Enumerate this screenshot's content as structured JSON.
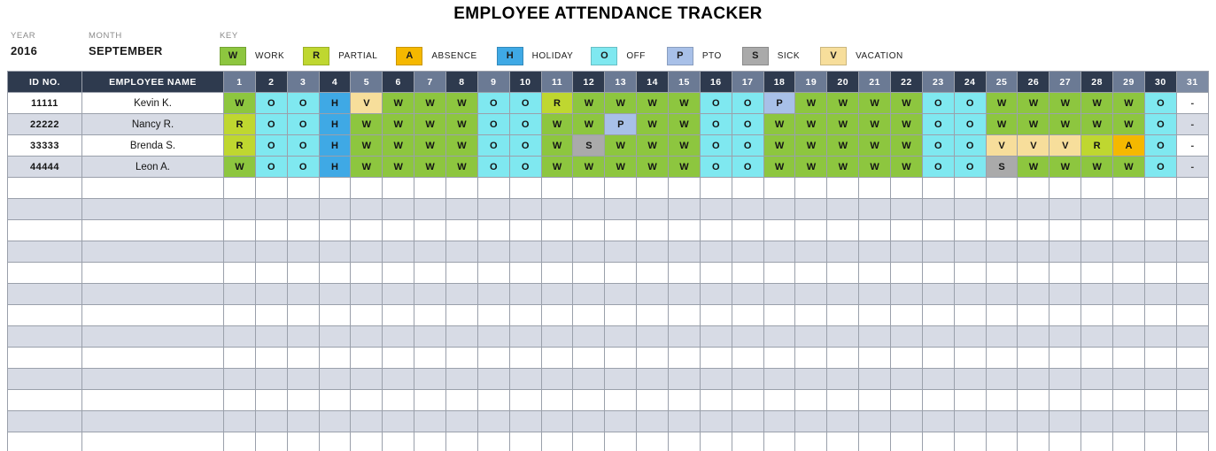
{
  "title": "EMPLOYEE ATTENDANCE TRACKER",
  "meta": {
    "year_label": "YEAR",
    "year_value": "2016",
    "month_label": "MONTH",
    "month_value": "SEPTEMBER",
    "key_label": "KEY"
  },
  "legend": [
    {
      "code": "W",
      "label": "WORK",
      "color": "#8DC63F"
    },
    {
      "code": "R",
      "label": "PARTIAL",
      "color": "#BFD730"
    },
    {
      "code": "A",
      "label": "ABSENCE",
      "color": "#F5B800"
    },
    {
      "code": "H",
      "label": "HOLIDAY",
      "color": "#3FA9E5"
    },
    {
      "code": "O",
      "label": "OFF",
      "color": "#7FE8F0"
    },
    {
      "code": "P",
      "label": "PTO",
      "color": "#A8C0E8"
    },
    {
      "code": "S",
      "label": "SICK",
      "color": "#AAAAAA"
    },
    {
      "code": "V",
      "label": "VACATION",
      "color": "#F7DE9B"
    }
  ],
  "table": {
    "col_id_header": "ID NO.",
    "col_name_header": "EMPLOYEE NAME",
    "days": [
      1,
      2,
      3,
      4,
      5,
      6,
      7,
      8,
      9,
      10,
      11,
      12,
      13,
      14,
      15,
      16,
      17,
      18,
      19,
      20,
      21,
      22,
      23,
      24,
      25,
      26,
      27,
      28,
      29,
      30,
      31
    ],
    "empty_row_count": 13,
    "rows": [
      {
        "id": "11111",
        "name": "Kevin K.",
        "codes": [
          "W",
          "O",
          "O",
          "H",
          "V",
          "W",
          "W",
          "W",
          "O",
          "O",
          "R",
          "W",
          "W",
          "W",
          "W",
          "O",
          "O",
          "P",
          "W",
          "W",
          "W",
          "W",
          "O",
          "O",
          "W",
          "W",
          "W",
          "W",
          "W",
          "O",
          "-"
        ]
      },
      {
        "id": "22222",
        "name": "Nancy R.",
        "codes": [
          "R",
          "O",
          "O",
          "H",
          "W",
          "W",
          "W",
          "W",
          "O",
          "O",
          "W",
          "W",
          "P",
          "W",
          "W",
          "O",
          "O",
          "W",
          "W",
          "W",
          "W",
          "W",
          "O",
          "O",
          "W",
          "W",
          "W",
          "W",
          "W",
          "O",
          "-"
        ]
      },
      {
        "id": "33333",
        "name": "Brenda S.",
        "codes": [
          "R",
          "O",
          "O",
          "H",
          "W",
          "W",
          "W",
          "W",
          "O",
          "O",
          "W",
          "S",
          "W",
          "W",
          "W",
          "O",
          "O",
          "W",
          "W",
          "W",
          "W",
          "W",
          "O",
          "O",
          "V",
          "V",
          "V",
          "R",
          "A",
          "O",
          "-"
        ]
      },
      {
        "id": "44444",
        "name": "Leon A.",
        "codes": [
          "W",
          "O",
          "O",
          "H",
          "W",
          "W",
          "W",
          "W",
          "O",
          "O",
          "W",
          "W",
          "W",
          "W",
          "W",
          "O",
          "O",
          "W",
          "W",
          "W",
          "W",
          "W",
          "O",
          "O",
          "S",
          "W",
          "W",
          "W",
          "W",
          "O",
          "-"
        ]
      }
    ]
  }
}
